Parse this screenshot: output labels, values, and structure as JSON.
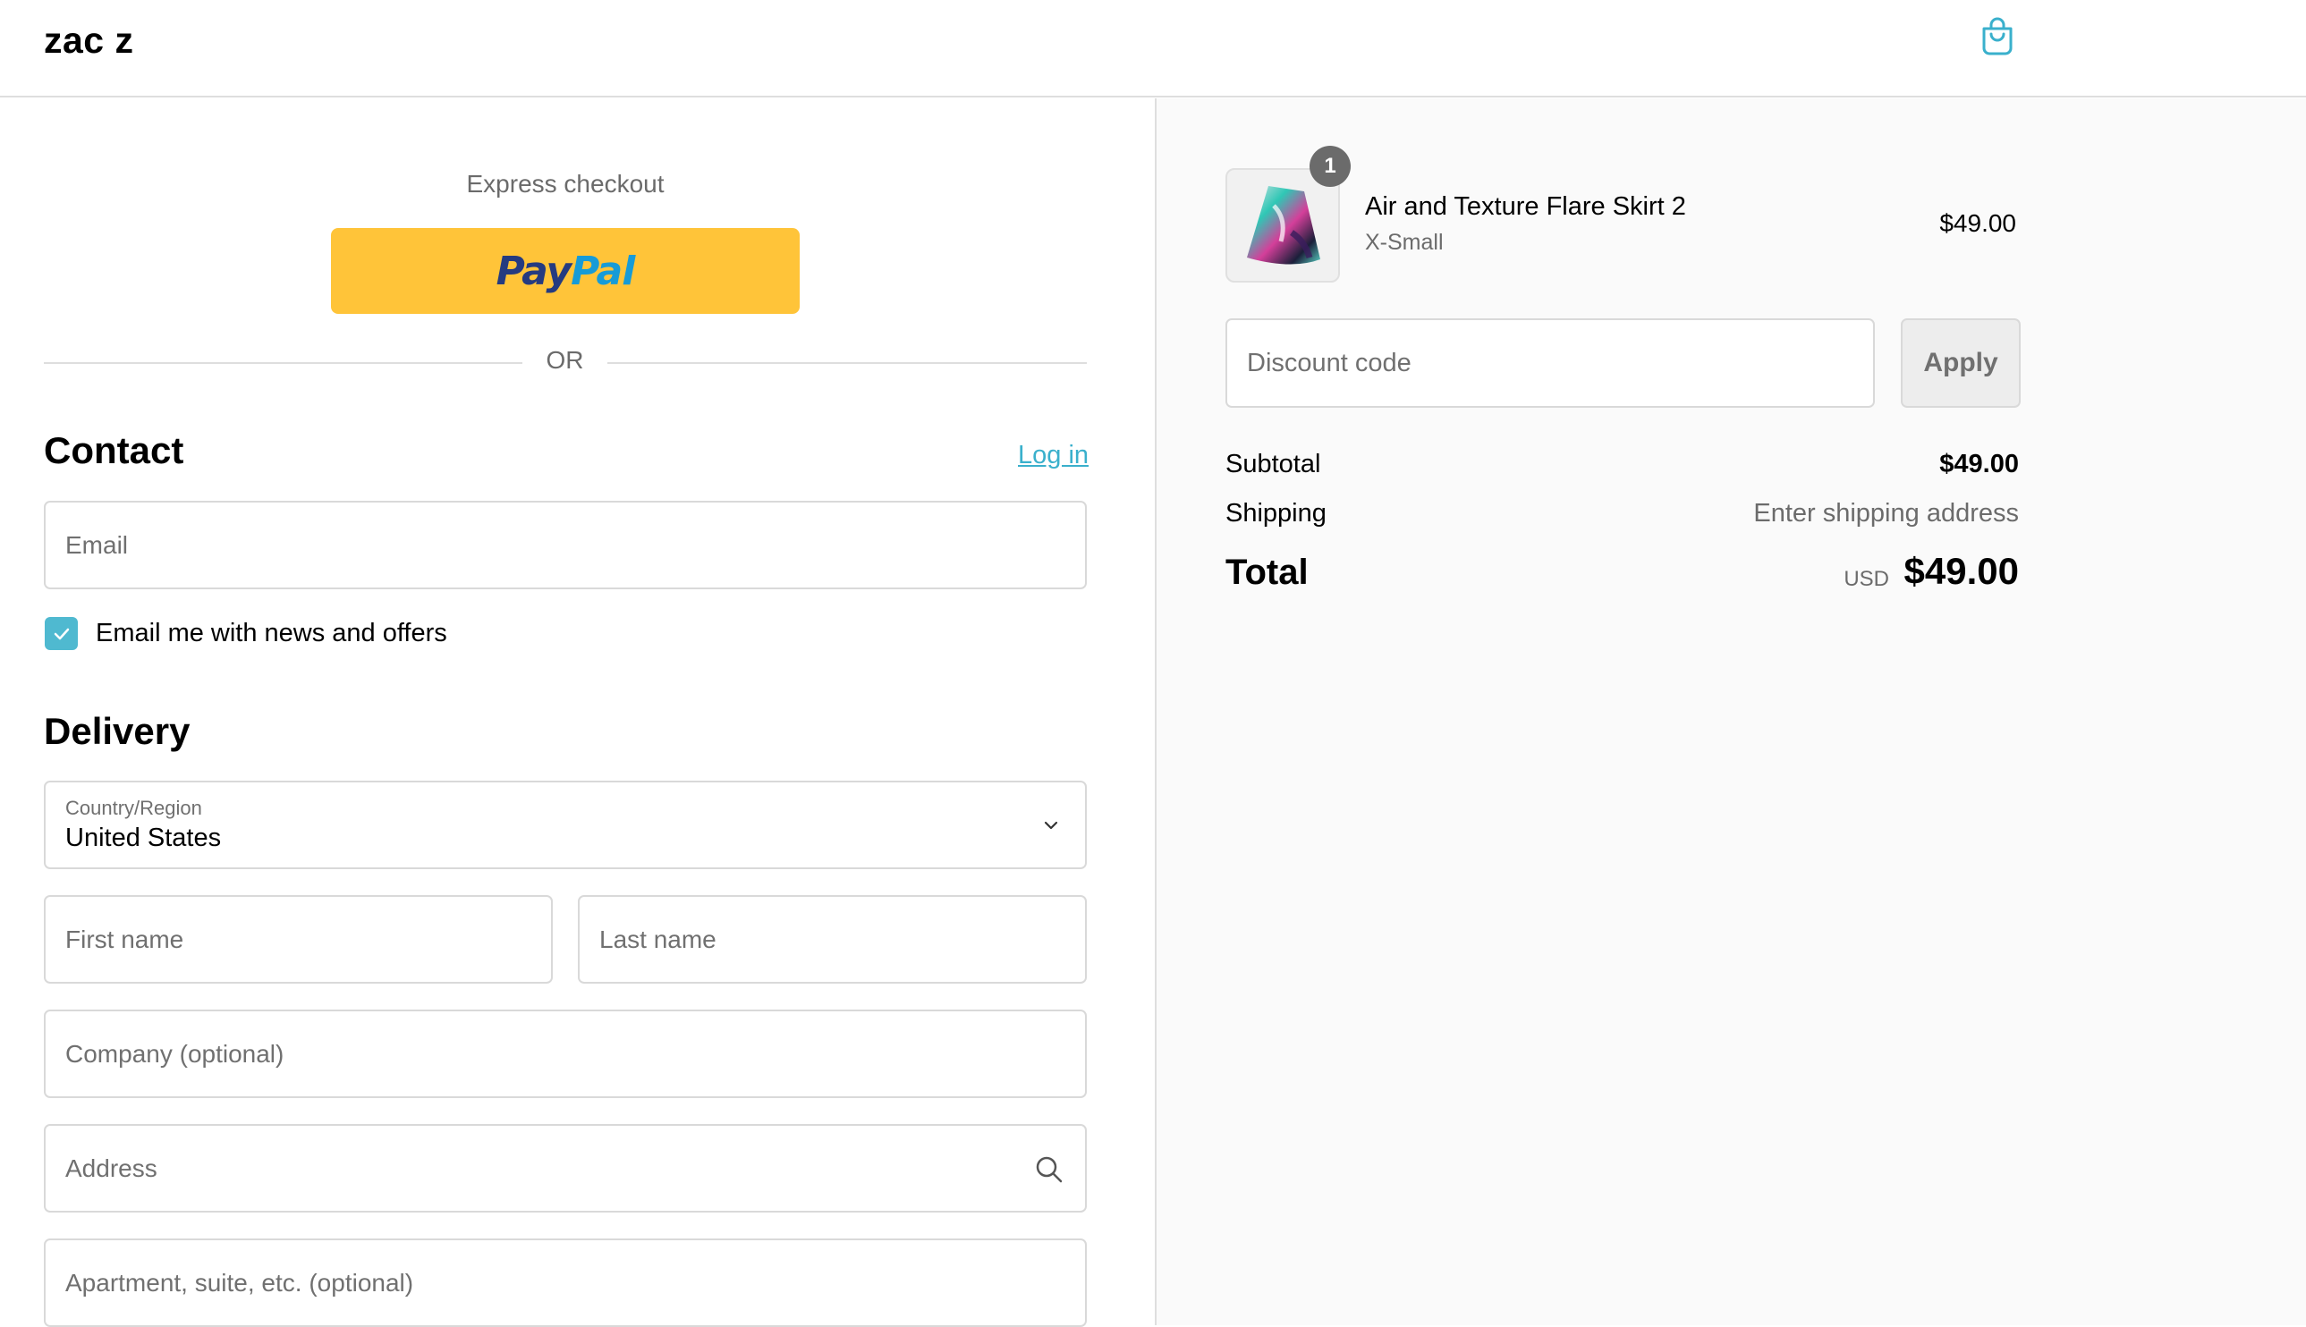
{
  "header": {
    "shop_name": "zac z",
    "cart_icon": "shopping-bag-icon"
  },
  "express": {
    "title": "Express checkout",
    "paypal_pay": "Pay",
    "paypal_pal": "Pal",
    "or_text": "OR"
  },
  "contact": {
    "title": "Contact",
    "login_label": "Log in",
    "email_placeholder": "Email",
    "newsletter_label": "Email me with news and offers",
    "newsletter_checked": true
  },
  "delivery": {
    "title": "Delivery",
    "country_label": "Country/Region",
    "country_value": "United States",
    "first_name_placeholder": "First name",
    "last_name_placeholder": "Last name",
    "company_placeholder": "Company (optional)",
    "address_placeholder": "Address",
    "apartment_placeholder": "Apartment, suite, etc. (optional)"
  },
  "order": {
    "item": {
      "quantity": "1",
      "name": "Air and Texture Flare Skirt 2",
      "variant": "X-Small",
      "price": "$49.00"
    },
    "discount_placeholder": "Discount code",
    "apply_label": "Apply",
    "subtotal_label": "Subtotal",
    "subtotal_value": "$49.00",
    "shipping_label": "Shipping",
    "shipping_value": "Enter shipping address",
    "total_label": "Total",
    "currency": "USD",
    "total_value": "$49.00"
  },
  "colors": {
    "accent": "#3ab0cc",
    "paypal_yellow": "#ffc439",
    "checkbox": "#4fb9d0"
  }
}
